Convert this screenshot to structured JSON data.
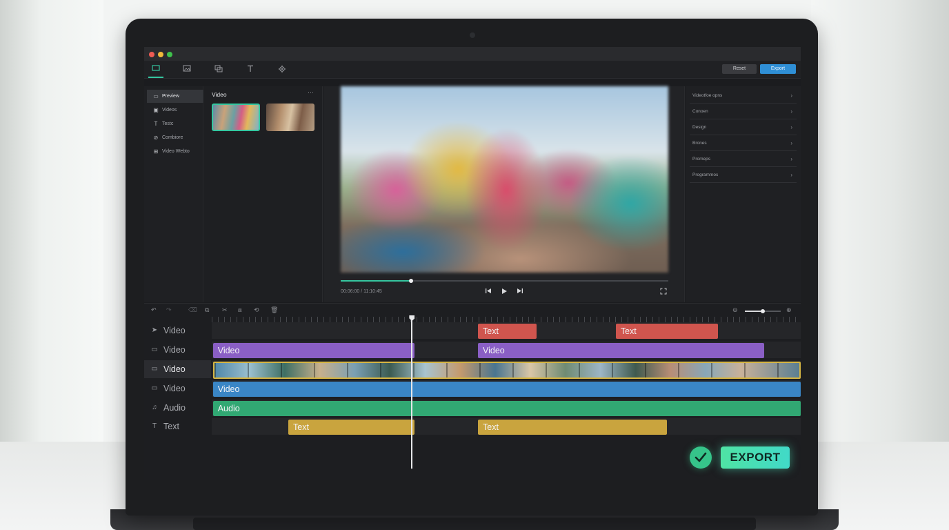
{
  "toolbar": {
    "tabs": [
      {
        "icon": "monitor-icon"
      },
      {
        "icon": "image-icon"
      },
      {
        "icon": "layers-icon"
      },
      {
        "icon": "text-icon"
      },
      {
        "icon": "gear-icon"
      }
    ],
    "reset_label": "Reset",
    "export_label": "Export"
  },
  "sidebar": {
    "items": [
      {
        "label": "Preview",
        "icon": "monitor-icon",
        "active": true
      },
      {
        "label": "Videos",
        "icon": "film-icon",
        "active": false
      },
      {
        "label": "Testc",
        "icon": "text-icon",
        "active": false
      },
      {
        "label": "Combiore",
        "icon": "transition-icon",
        "active": false
      },
      {
        "label": "Video Webto",
        "icon": "grid-icon",
        "active": false
      }
    ]
  },
  "media": {
    "title": "Video",
    "more_icon": "more-icon"
  },
  "player": {
    "timecode": "00:06:00 / 11:10:45",
    "progress": 0.215,
    "controls": [
      "skip-back-icon",
      "play-icon",
      "skip-forward-icon",
      "fullscreen-icon"
    ]
  },
  "inspector": {
    "items": [
      "Videotfoe opns",
      "Conoen",
      "Design",
      "Brones",
      "Promeps",
      "Programmos"
    ]
  },
  "timeline": {
    "tools": [
      "undo-icon",
      "redo-icon",
      "delete-icon",
      "copy-icon",
      "scissors-icon",
      "split-icon",
      "loop-icon",
      "trash-icon"
    ],
    "zoom_level": 0.5,
    "playhead_position": 0.34,
    "tracks": [
      {
        "label": "Video",
        "icon": "cursor-icon",
        "active": false,
        "clips": [
          {
            "label": "Text",
            "color": "#d0554e",
            "start": 0.452,
            "end": 0.551
          },
          {
            "label": "Text",
            "color": "#d0554e",
            "start": 0.686,
            "end": 0.859
          }
        ]
      },
      {
        "label": "Video",
        "icon": "video-icon",
        "active": false,
        "clips": [
          {
            "label": "Video",
            "color": "#8a5fc5",
            "start": 0.002,
            "end": 0.344
          },
          {
            "label": "Video",
            "color": "#8a5fc5",
            "start": 0.452,
            "end": 0.938
          }
        ]
      },
      {
        "label": "Video",
        "icon": "video-icon",
        "active": true,
        "clips": [
          {
            "label": "",
            "color": "#d6b542",
            "start": 0.002,
            "end": 1.0,
            "filmstrip": true
          }
        ]
      },
      {
        "label": "Video",
        "icon": "video-icon",
        "active": false,
        "clips": [
          {
            "label": "Video",
            "color": "#3a86c6",
            "start": 0.002,
            "end": 1.0
          }
        ]
      },
      {
        "label": "Audio",
        "icon": "music-icon",
        "active": false,
        "clips": [
          {
            "label": "Audio",
            "color": "#31a873",
            "start": 0.002,
            "end": 1.0
          }
        ]
      },
      {
        "label": "Text",
        "icon": "text-icon",
        "active": false,
        "clips": [
          {
            "label": "Text",
            "color": "#c9a43e",
            "start": 0.13,
            "end": 0.344
          },
          {
            "label": "Text",
            "color": "#c9a43e",
            "start": 0.452,
            "end": 0.773
          }
        ]
      }
    ]
  },
  "actions": {
    "confirm_icon": "check-icon",
    "export_label": "EXPORT"
  }
}
